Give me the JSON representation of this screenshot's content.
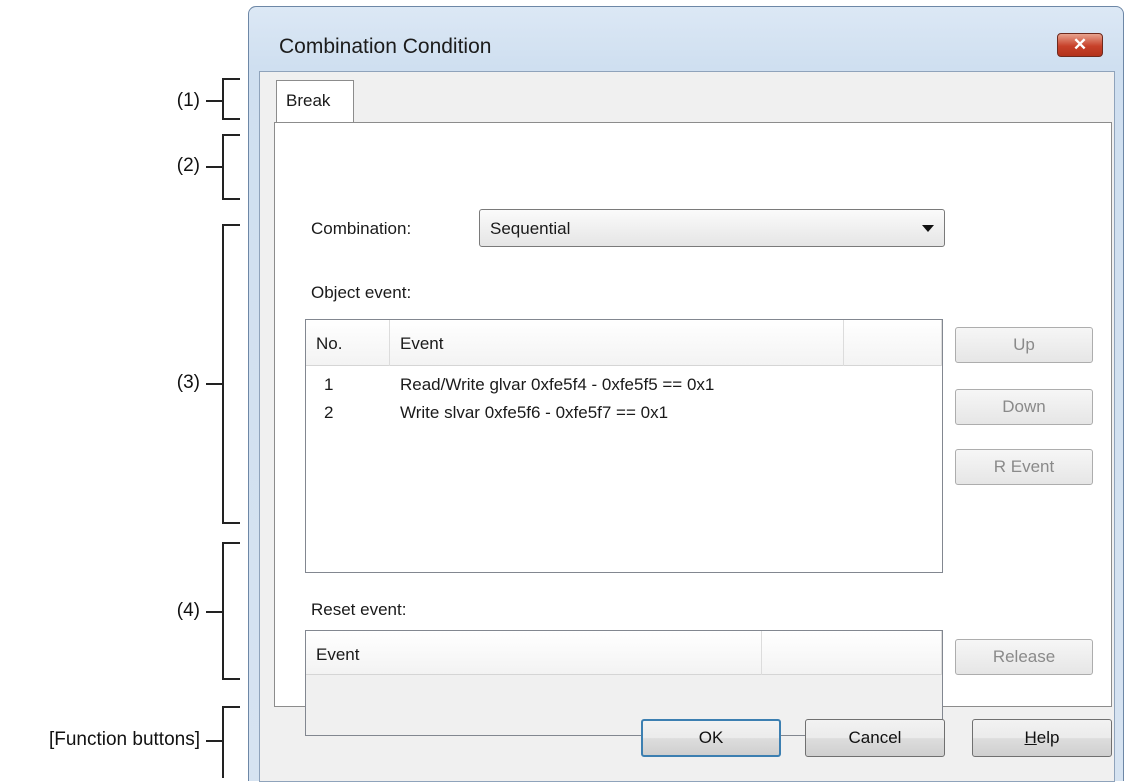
{
  "annotations": {
    "tab_section": "(1)",
    "combination_section": "(2)",
    "object_event_section": "(3)",
    "reset_event_section": "(4)",
    "function_buttons": "[Function buttons]"
  },
  "window": {
    "title": "Combination Condition",
    "close_glyph": "✕"
  },
  "tabs": [
    {
      "label": "Break",
      "selected": true
    }
  ],
  "combination": {
    "label": "Combination:",
    "selected_value": "Sequential"
  },
  "object_event": {
    "label": "Object event:",
    "columns": [
      "No.",
      "Event",
      ""
    ],
    "rows": [
      {
        "no": "1",
        "event": "Read/Write glvar 0xfe5f4 - 0xfe5f5 == 0x1"
      },
      {
        "no": "2",
        "event": "Write slvar 0xfe5f6 - 0xfe5f7 == 0x1"
      }
    ],
    "buttons": {
      "up": "Up",
      "down": "Down",
      "r_event": "R Event"
    }
  },
  "reset_event": {
    "label": "Reset event:",
    "columns": [
      "Event",
      ""
    ],
    "rows": [],
    "release_button": "Release"
  },
  "footer": {
    "ok": "OK",
    "cancel": "Cancel",
    "help_hotkey": "H",
    "help_rest": "elp"
  },
  "colors": {
    "window_frame": "#d7e4f2",
    "close_button": "#c7412a",
    "default_button_border": "#3c7fb1",
    "disabled_text": "#8a8a8a"
  }
}
